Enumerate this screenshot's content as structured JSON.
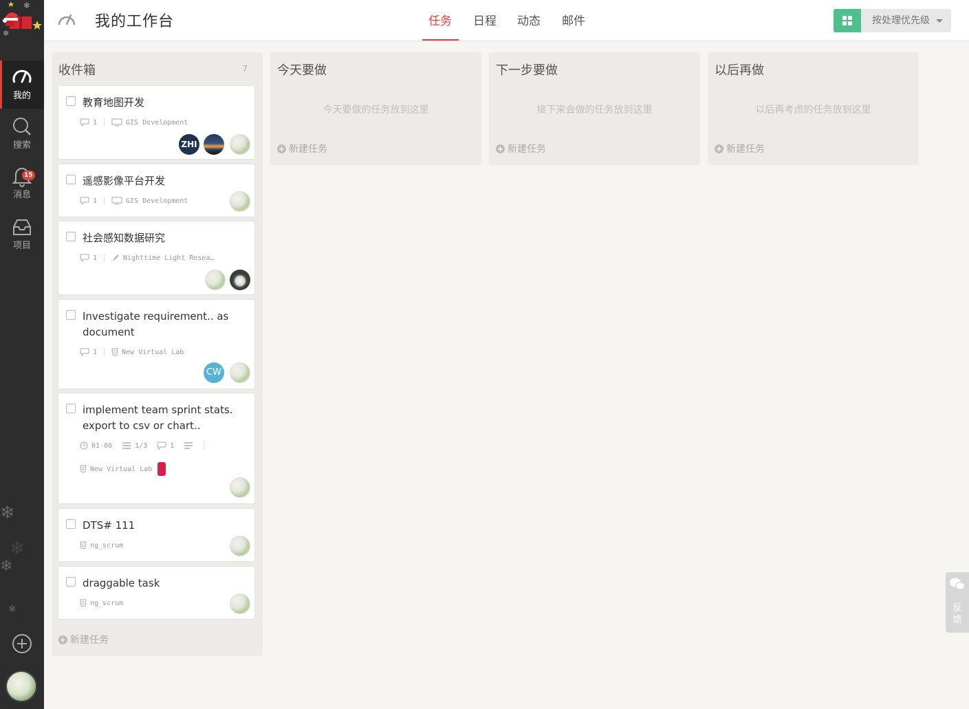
{
  "sidebar": {
    "nav": [
      {
        "label": "我的",
        "icon": "dashboard-icon",
        "active": true
      },
      {
        "label": "搜索",
        "icon": "search-icon"
      },
      {
        "label": "消息",
        "icon": "bell-icon",
        "badge": "15"
      },
      {
        "label": "项目",
        "icon": "inbox-icon"
      }
    ]
  },
  "header": {
    "title": "我的工作台",
    "tabs": [
      "任务",
      "日程",
      "动态",
      "邮件"
    ],
    "active_tab": "任务",
    "sort_label": "按处理优先级"
  },
  "columns": [
    {
      "title": "收件箱",
      "count": "7",
      "new_task": "新建任务"
    },
    {
      "title": "今天要做",
      "placeholder": "今天要做的任务放到这里",
      "new_task": "新建任务"
    },
    {
      "title": "下一步要做",
      "placeholder": "接下来会做的任务放到这里",
      "new_task": "新建任务"
    },
    {
      "title": "以后再做",
      "placeholder": "以后再考虑的任务放到这里",
      "new_task": "新建任务"
    }
  ],
  "cards": [
    {
      "title": "教育地图开发",
      "comments": "1",
      "project": "GIS Development",
      "avatars": [
        "ZHI"
      ]
    },
    {
      "title": "遥感影像平台开发",
      "comments": "1",
      "project": "GIS Development"
    },
    {
      "title": "社会感知数据研究",
      "comments": "1",
      "project": "Nighttime Light Resea…"
    },
    {
      "title": "Investigate requirement.. as document",
      "comments": "1",
      "project": "New Virtual Lab",
      "avatars": [
        "CW"
      ]
    },
    {
      "title": "implement team sprint stats. export to csv or chart..",
      "due": "01-06",
      "checklist": "1/3",
      "comments": "1",
      "project": "New Virtual Lab"
    },
    {
      "title": "DTS# 111",
      "project": "ng_scrum"
    },
    {
      "title": "draggable task",
      "project": "ng_scrum"
    }
  ],
  "feedback": {
    "label": "反馈"
  },
  "colors": {
    "accent": "#e0433b",
    "green": "#4fc08d",
    "sidebar": "#2d2d2d"
  }
}
